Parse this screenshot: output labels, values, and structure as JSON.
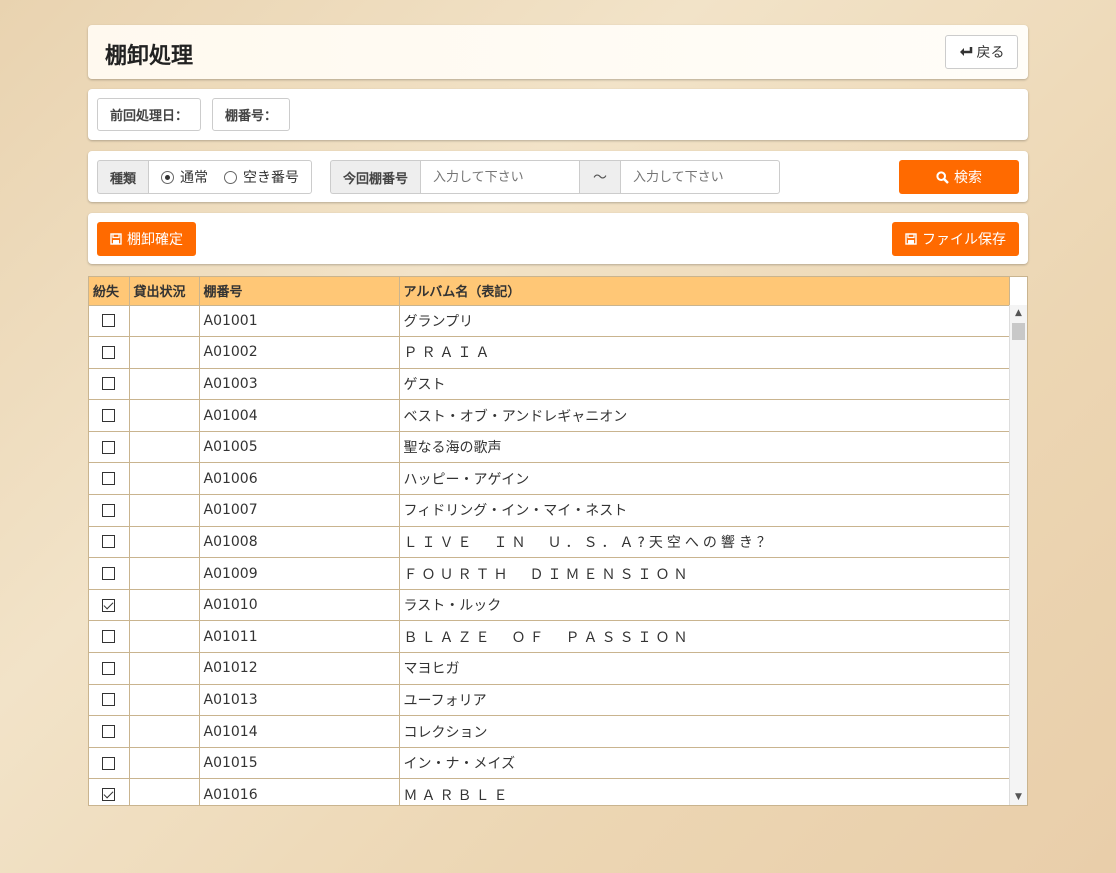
{
  "header": {
    "title": "棚卸処理",
    "back_label": "戻る"
  },
  "info": {
    "last_date_label": "前回処理日：",
    "shelf_label": "棚番号："
  },
  "search": {
    "type_label": "種類",
    "opt_normal": "通常",
    "opt_empty": "空き番号",
    "shelf_label": "今回棚番号",
    "from_placeholder": "入力して下さい",
    "to_placeholder": "入力して下さい",
    "tilde": "～",
    "search_label": "検索"
  },
  "actions": {
    "confirm_label": "棚卸確定",
    "save_label": "ファイル保存"
  },
  "table": {
    "columns": [
      "紛失",
      "貸出状況",
      "棚番号",
      "アルバム名（表記）"
    ],
    "rows": [
      {
        "lost": false,
        "status": "",
        "shelf": "A01001",
        "album": "グランプリ"
      },
      {
        "lost": false,
        "status": "",
        "shelf": "A01002",
        "album": "ＰＲＡＩＡ"
      },
      {
        "lost": false,
        "status": "",
        "shelf": "A01003",
        "album": "ゲスト"
      },
      {
        "lost": false,
        "status": "",
        "shelf": "A01004",
        "album": "ベスト・オブ・アンドレギャニオン"
      },
      {
        "lost": false,
        "status": "",
        "shelf": "A01005",
        "album": "聖なる海の歌声"
      },
      {
        "lost": false,
        "status": "",
        "shelf": "A01006",
        "album": "ハッピー・アゲイン"
      },
      {
        "lost": false,
        "status": "",
        "shelf": "A01007",
        "album": "フィドリング・イン・マイ・ネスト"
      },
      {
        "lost": false,
        "status": "",
        "shelf": "A01008",
        "album": "ＬＩＶＥ　ＩＮ　Ｕ．Ｓ．Ａ?天空への響き？"
      },
      {
        "lost": false,
        "status": "",
        "shelf": "A01009",
        "album": "ＦＯＵＲＴＨ　ＤＩＭＥＮＳＩＯＮ"
      },
      {
        "lost": true,
        "status": "",
        "shelf": "A01010",
        "album": "ラスト・ルック"
      },
      {
        "lost": false,
        "status": "",
        "shelf": "A01011",
        "album": "ＢＬＡＺＥ　ＯＦ　ＰＡＳＳＩＯＮ"
      },
      {
        "lost": false,
        "status": "",
        "shelf": "A01012",
        "album": "マヨヒガ"
      },
      {
        "lost": false,
        "status": "",
        "shelf": "A01013",
        "album": "ユーフォリア"
      },
      {
        "lost": false,
        "status": "",
        "shelf": "A01014",
        "album": "コレクション"
      },
      {
        "lost": false,
        "status": "",
        "shelf": "A01015",
        "album": "イン・ナ・メイズ"
      },
      {
        "lost": true,
        "status": "",
        "shelf": "A01016",
        "album": "ＭＡＲＢＬＥ"
      }
    ]
  },
  "colors": {
    "accent": "#ff6a00",
    "table_header": "#ffc776",
    "border": "#c9b48f"
  }
}
